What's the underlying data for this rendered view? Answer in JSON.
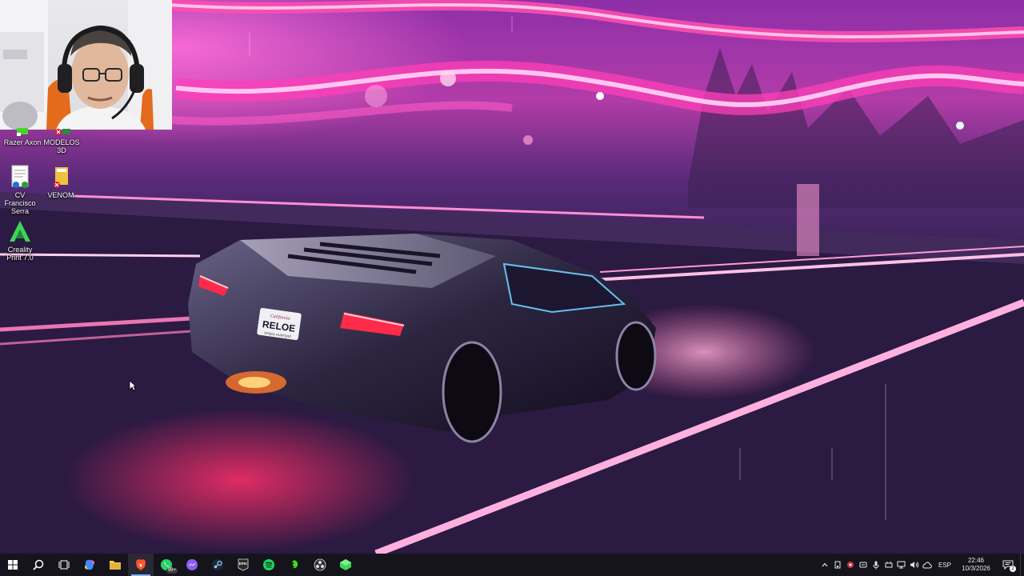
{
  "desktop": {
    "icons": [
      {
        "label": "Razer Axon",
        "icon": "razer-axon-icon"
      },
      {
        "label": "MODELOS 3D",
        "icon": "folder-shortcut-icon"
      },
      {
        "label": "CV Francisco Serra",
        "icon": "document-icon"
      },
      {
        "label": "VENOM",
        "icon": "folder-icon"
      },
      {
        "label": "Creality Print 7.0",
        "icon": "creality-print-icon"
      }
    ],
    "wallpaper": {
      "description_icon": "lamborghini-wallpaper",
      "license_plate_top": "California",
      "license_plate": "RELOE",
      "license_plate_bottom": "SPEED HUNTERS"
    }
  },
  "taskbar": {
    "apps": [
      {
        "name": "start-button",
        "icon": "windows-start-icon"
      },
      {
        "name": "search-button",
        "icon": "search-icon"
      },
      {
        "name": "task-view-button",
        "icon": "task-view-icon"
      },
      {
        "name": "copilot-button",
        "icon": "copilot-icon"
      },
      {
        "name": "file-explorer-button",
        "icon": "folder-icon"
      },
      {
        "name": "brave-button",
        "icon": "brave-icon",
        "active": true
      },
      {
        "name": "whatsapp-button",
        "icon": "whatsapp-icon",
        "badge": "99+"
      },
      {
        "name": "messenger-button",
        "icon": "messenger-icon"
      },
      {
        "name": "steam-button",
        "icon": "steam-icon"
      },
      {
        "name": "epic-games-button",
        "icon": "epic-games-icon",
        "text": "EPIC"
      },
      {
        "name": "spotify-button",
        "icon": "spotify-icon"
      },
      {
        "name": "razer-synapse-button",
        "icon": "razer-icon"
      },
      {
        "name": "obs-button",
        "icon": "obs-icon"
      },
      {
        "name": "creality-button",
        "icon": "creality-icon"
      }
    ],
    "tray": {
      "language": "ESP",
      "time": "22:46",
      "date": "10/3/2026",
      "notification_count": "2"
    }
  },
  "colors": {
    "taskbar_bg": "#15141c",
    "accent": "#7fb3ff",
    "neon_pink": "#ff3fb8"
  }
}
